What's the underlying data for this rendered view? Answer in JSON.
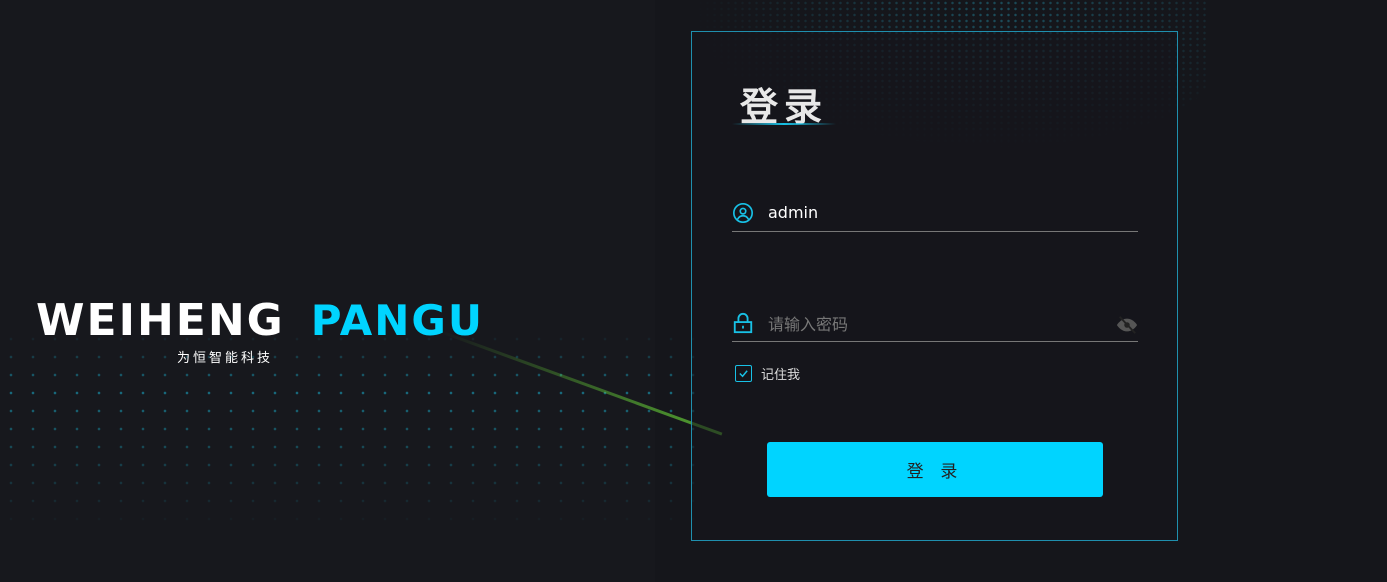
{
  "brand": {
    "logo_text": "WEIHENG",
    "product": "PANGU",
    "subtitle": "为恒智能科技"
  },
  "login": {
    "title": "登录",
    "username": {
      "value": "admin",
      "icon": "user-circle-icon"
    },
    "password": {
      "placeholder": "请输入密码",
      "icon": "lock-icon",
      "toggle_icon": "eye-off-icon"
    },
    "remember": {
      "label": "记住我",
      "checked": true
    },
    "submit_label": "登 录"
  },
  "colors": {
    "accent": "#00d4ff",
    "border": "#1f8fae",
    "background": "#15161b"
  }
}
